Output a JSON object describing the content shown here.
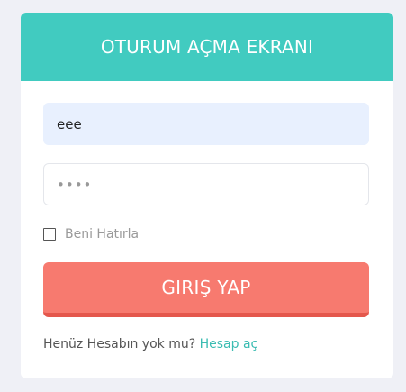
{
  "header": {
    "title": "OTURUM AÇMA EKRANI"
  },
  "form": {
    "username_value": "eee",
    "password_value": "••••",
    "remember_label": "Beni Hatırla",
    "remember_checked": false,
    "submit_label": "GIRIŞ YAP"
  },
  "footer": {
    "question": "Henüz Hesabın yok mu?",
    "link_label": "Hesap aç"
  },
  "colors": {
    "header": "#41cbc0",
    "button": "#f77a6f",
    "link": "#3bbcb2",
    "background": "#eff0f6"
  }
}
